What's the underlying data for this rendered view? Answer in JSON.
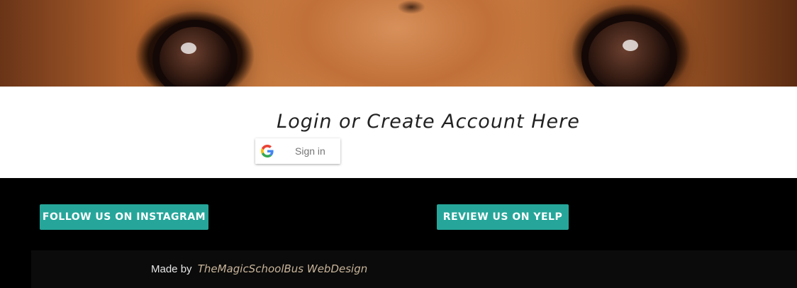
{
  "hero": {
    "image_alt": "close-up of a dog's eyes"
  },
  "login": {
    "title": "Login or Create Account Here",
    "signin_label": "Sign in"
  },
  "footer": {
    "instagram_label": "FOLLOW US ON INSTAGRAM",
    "yelp_label": "REVIEW US ON YELP",
    "made_by_prefix": "Made by",
    "made_by_link": "TheMagicSchoolBus WebDesign"
  },
  "colors": {
    "accent": "#26a69a",
    "footer_bg": "#000000",
    "footer_bar_bg": "#0b0b0b"
  },
  "icons": {
    "signin": "google-icon"
  }
}
